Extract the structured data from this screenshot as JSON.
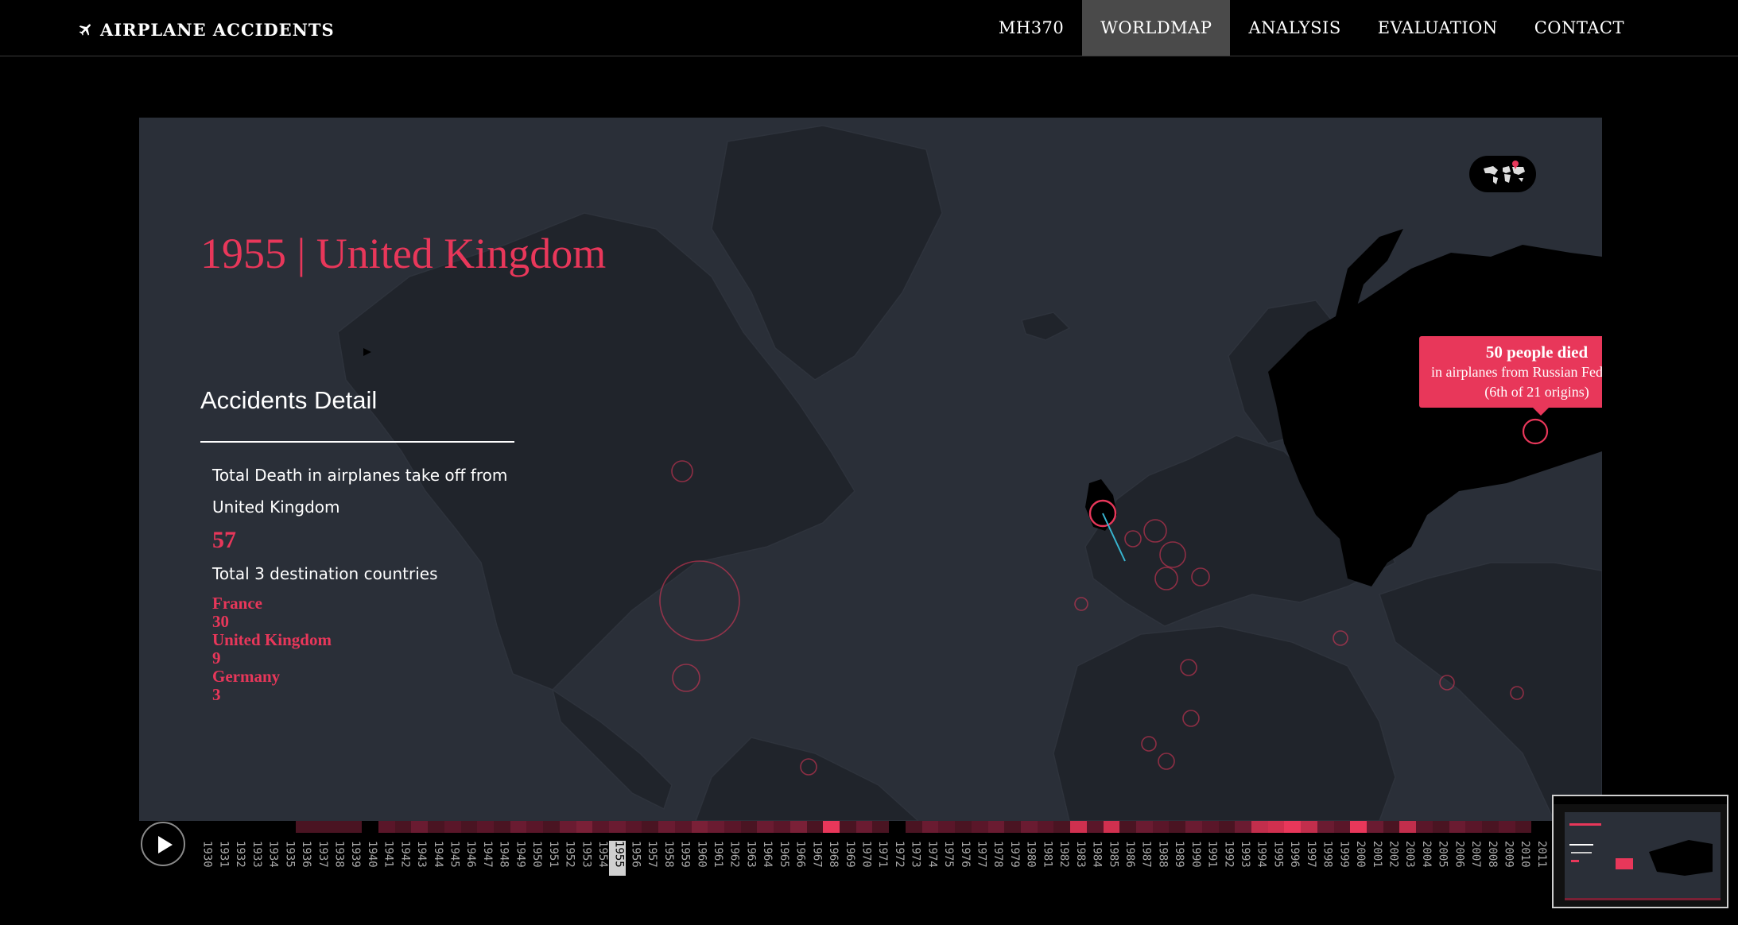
{
  "nav": {
    "brand": "AIRPLANE ACCIDENTS",
    "items": [
      "MH370",
      "WORLDMAP",
      "ANALYSIS",
      "EVALUATION",
      "CONTACT"
    ],
    "active": "WORLDMAP"
  },
  "map": {
    "headline": "1955 | United Kingdom",
    "detail": {
      "title": "Accidents Detail",
      "total_death_label_1": "Total Death in airplanes take off from",
      "total_death_label_2": "United Kingdom",
      "total_death_value": "57",
      "dest_label": "Total 3 destination countries",
      "destinations": [
        {
          "country": "France",
          "count": "30"
        },
        {
          "country": "United Kingdom",
          "count": "9"
        },
        {
          "country": "Germany",
          "count": "3"
        }
      ]
    },
    "tooltip": {
      "line1": "50 people died",
      "line2": "in airplanes from Russian Federation",
      "line3": "(6th of 21 origins)"
    },
    "colors": {
      "accent": "#e8375a",
      "map_bg": "#2a2f38",
      "land": "#20242b",
      "highlight": "#000000",
      "connector": "#38b5d0"
    },
    "icons": [
      "airplane-icon",
      "world-map-icon",
      "play-icon"
    ]
  },
  "timeline": {
    "selected_year": "1955",
    "years": [
      "1930",
      "1931",
      "1932",
      "1933",
      "1934",
      "1935",
      "1936",
      "1937",
      "1938",
      "1939",
      "1940",
      "1941",
      "1942",
      "1943",
      "1944",
      "1945",
      "1946",
      "1947",
      "1948",
      "1949",
      "1950",
      "1951",
      "1952",
      "1953",
      "1954",
      "1955",
      "1956",
      "1957",
      "1958",
      "1959",
      "1960",
      "1961",
      "1962",
      "1963",
      "1964",
      "1965",
      "1966",
      "1967",
      "1968",
      "1969",
      "1970",
      "1971",
      "1972",
      "1973",
      "1974",
      "1975",
      "1976",
      "1977",
      "1978",
      "1979",
      "1980",
      "1981",
      "1982",
      "1983",
      "1984",
      "1985",
      "1986",
      "1987",
      "1988",
      "1989",
      "1990",
      "1991",
      "1992",
      "1993",
      "1994",
      "1995",
      "1996",
      "1997",
      "1998",
      "1999",
      "2000",
      "2001",
      "2002",
      "2003",
      "2004",
      "2005",
      "2006",
      "2007",
      "2008",
      "2009",
      "2010",
      "2011"
    ]
  }
}
